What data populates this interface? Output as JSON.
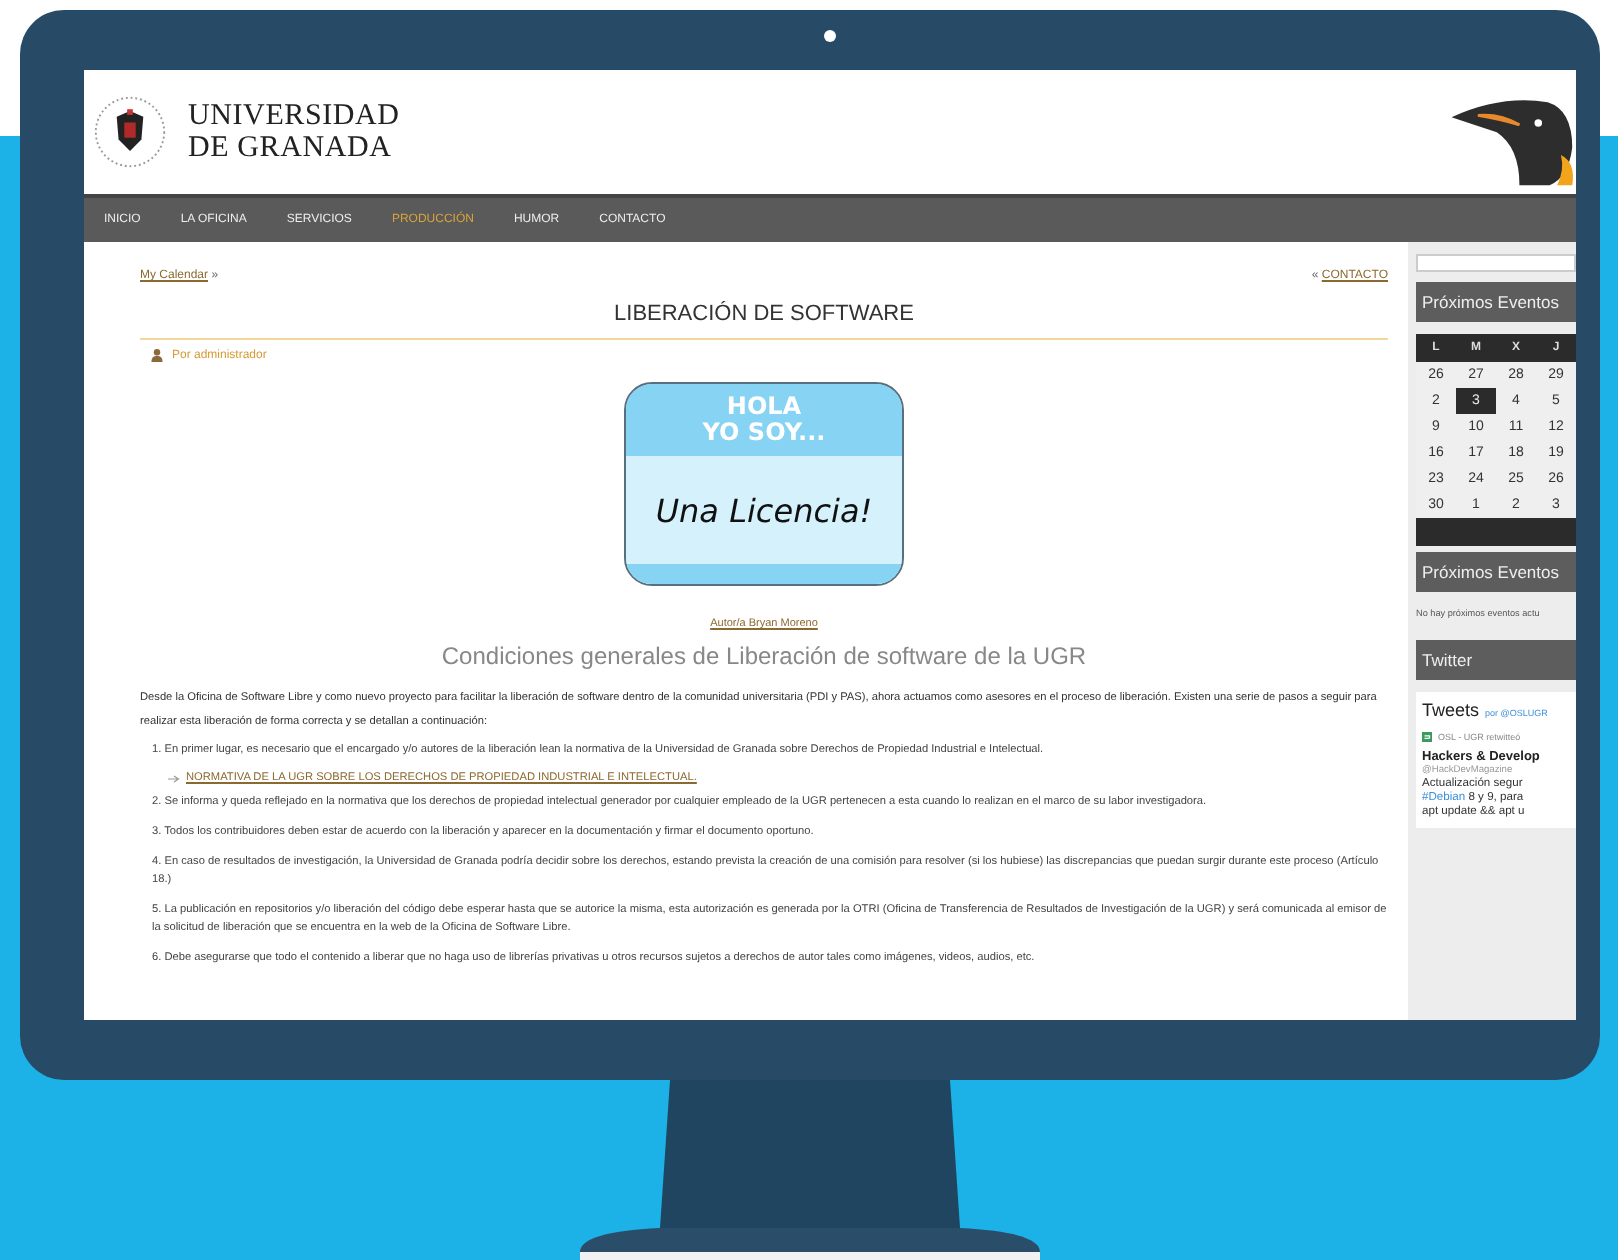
{
  "header": {
    "logo_line1": "UNIVERSIDAD",
    "logo_line2": "DE GRANADA"
  },
  "nav": [
    {
      "label": "INICIO",
      "selected": false
    },
    {
      "label": "LA OFICINA",
      "selected": false
    },
    {
      "label": "SERVICIOS",
      "selected": false
    },
    {
      "label": "PRODUCCIÓN",
      "selected": true
    },
    {
      "label": "HUMOR",
      "selected": false
    },
    {
      "label": "CONTACTO",
      "selected": false
    }
  ],
  "breadcrumb": {
    "link": "My Calendar",
    "separator": "»",
    "next_marker": "«",
    "next_link": "CONTACTO"
  },
  "post": {
    "title": "LIBERACIÓN DE SOFTWARE",
    "author": "Por administrador",
    "sign": {
      "top_line1": "HOLA",
      "top_line2": "YO SOY...",
      "handwritten": "Una Licencia!"
    },
    "credit": "Autor/a Bryan Moreno",
    "heading": "Condiciones generales de Liberación de software de la UGR",
    "intro": "Desde la Oficina de Software Libre y como nuevo proyecto para facilitar la liberación de software dentro de la comunidad universitaria (PDI y PAS), ahora actuamos como asesores en el proceso de liberación. Existen una serie de pasos a seguir para realizar esta liberación de forma correcta y se detallan a continuación:",
    "steps": [
      {
        "text": "1. En primer lugar, es necesario que el encargado y/o autores de la liberación lean la normativa de la Universidad de Granada sobre Derechos de Propiedad Industrial e Intelectual.",
        "link": "NORMATIVA DE LA UGR SOBRE LOS DERECHOS DE PROPIEDAD INDUSTRIAL E INTELECTUAL."
      },
      {
        "text": "2. Se informa y queda reflejado en la normativa que los derechos de propiedad intelectual generador por cualquier empleado de la UGR pertenecen a esta cuando lo realizan en el marco de su labor investigadora."
      },
      {
        "text": "3. Todos los contribuidores deben estar de acuerdo con la liberación y aparecer en la documentación y firmar el documento oportuno."
      },
      {
        "text": "4. En caso de resultados de investigación, la Universidad de Granada podría decidir sobre los derechos, estando prevista la creación de una comisión para resolver (si los hubiese) las discrepancias que puedan surgir durante este proceso (Artículo 18.)"
      },
      {
        "text": "5. La publicación en repositorios y/o liberación del código debe esperar hasta que se autorice la misma, esta autorización es generada por la OTRI (Oficina de Transferencia de Resultados de Investigación de la UGR) y será comunicada al emisor de la solicitud de liberación que se encuentra en la web de la Oficina de Software Libre."
      },
      {
        "text": "6. Debe asegurarse que todo el contenido a liberar que no haga uso de librerías privativas u otros recursos sujetos a derechos de autor tales como imágenes, videos, audios, etc."
      }
    ]
  },
  "sidebar": {
    "calendar_title": "Próximos Eventos",
    "weekdays": [
      "L",
      "M",
      "X",
      "J"
    ],
    "weeks": [
      [
        {
          "label": "26",
          "selected": false
        },
        {
          "label": "27",
          "selected": false
        },
        {
          "label": "28",
          "selected": false
        },
        {
          "label": "29",
          "selected": false
        }
      ],
      [
        {
          "label": "2",
          "selected": false
        },
        {
          "label": "3",
          "selected": true
        },
        {
          "label": "4",
          "selected": false
        },
        {
          "label": "5",
          "selected": false
        }
      ],
      [
        {
          "label": "9",
          "selected": false
        },
        {
          "label": "10",
          "selected": false
        },
        {
          "label": "11",
          "selected": false
        },
        {
          "label": "12",
          "selected": false
        }
      ],
      [
        {
          "label": "16",
          "selected": false
        },
        {
          "label": "17",
          "selected": false
        },
        {
          "label": "18",
          "selected": false
        },
        {
          "label": "19",
          "selected": false
        }
      ],
      [
        {
          "label": "23",
          "selected": false
        },
        {
          "label": "24",
          "selected": false
        },
        {
          "label": "25",
          "selected": false
        },
        {
          "label": "26",
          "selected": false
        }
      ],
      [
        {
          "label": "30",
          "selected": false
        },
        {
          "label": "1",
          "selected": false
        },
        {
          "label": "2",
          "selected": false
        },
        {
          "label": "3",
          "selected": false
        }
      ]
    ],
    "events_title": "Próximos Eventos",
    "events_empty": "No hay próximos eventos actu",
    "twitter_title": "Twitter",
    "tweets": {
      "title": "Tweets",
      "by": "por @OSLUGR",
      "retweet": "OSL - UGR retwitteó",
      "author": "Hackers & Develop",
      "handle": "@HackDevMagazine",
      "line1": "Actualización segur",
      "hashtag": "#Debian",
      "line2_rest": "8 y 9, para",
      "line3": "apt update && apt u"
    }
  }
}
